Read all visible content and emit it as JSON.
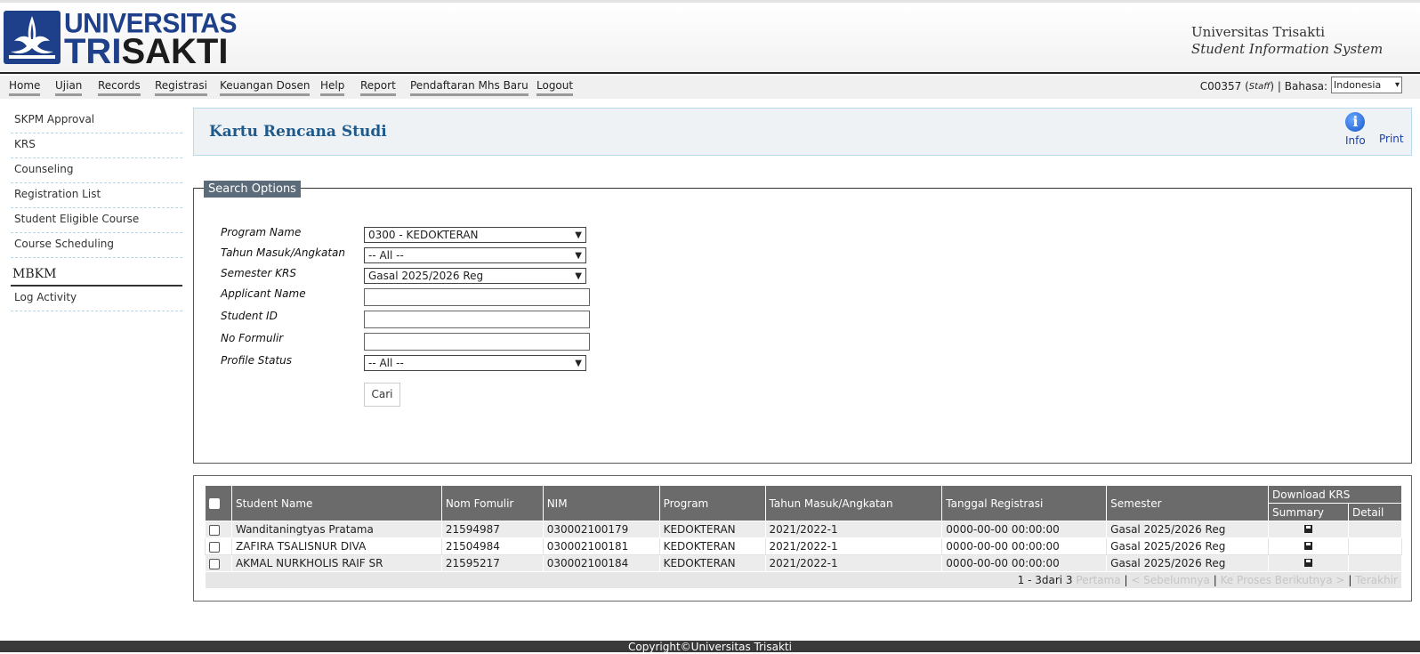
{
  "header": {
    "logo_line1": "UNIVERSITAS",
    "logo_tri": "TRI",
    "logo_sakti": "SAKTI",
    "university": "Universitas Trisakti",
    "system": "Student Information System"
  },
  "menu": {
    "items": [
      "Home",
      "Ujian",
      "Records",
      "Registrasi",
      "Keuangan Dosen",
      "Help",
      "Report",
      "Pendaftaran Mhs Baru",
      "Logout"
    ],
    "user_id": "C00357",
    "role": "Staff",
    "separator": "|",
    "language_label": "Bahasa:",
    "language_value": "Indonesia"
  },
  "sidebar": {
    "items": [
      "SKPM Approval",
      "KRS",
      "Counseling",
      "Registration List",
      "Student Eligible Course",
      "Course Scheduling"
    ],
    "heading": "MBKM",
    "items2": [
      "Log Activity"
    ]
  },
  "titlebar": {
    "title": "Kartu Rencana Studi",
    "info_label": "Info",
    "print_label": "Print"
  },
  "search": {
    "legend": "Search Options",
    "program_label": "Program Name",
    "program_value": "0300 - KEDOKTERAN",
    "tahun_label": "Tahun Masuk/Angkatan",
    "tahun_value": "-- All --",
    "semester_label": "Semester KRS",
    "semester_value": "Gasal 2025/2026 Reg",
    "applicant_label": "Applicant Name",
    "applicant_value": "",
    "student_id_label": "Student ID",
    "student_id_value": "",
    "formulir_label": "No Formulir",
    "formulir_value": "",
    "profile_label": "Profile Status",
    "profile_value": "-- All --",
    "button_label": "Cari"
  },
  "results": {
    "headers": {
      "student_name": "Student Name",
      "nom_formulir": "Nom Fomulir",
      "nim": "NIM",
      "program": "Program",
      "tahun": "Tahun Masuk/Angkatan",
      "tanggal": "Tanggal Registrasi",
      "semester": "Semester",
      "download": "Download KRS",
      "summary": "Summary",
      "detail": "Detail"
    },
    "rows": [
      {
        "name": "Wanditaningtyas Pratama",
        "formulir": "21594987",
        "nim": "030002100179",
        "program": "KEDOKTERAN",
        "tahun": "2021/2022-1",
        "tanggal": "0000-00-00 00:00:00",
        "semester": "Gasal 2025/2026 Reg"
      },
      {
        "name": "ZAFIRA TSALISNUR DIVA",
        "formulir": "21504984",
        "nim": "030002100181",
        "program": "KEDOKTERAN",
        "tahun": "2021/2022-1",
        "tanggal": "0000-00-00 00:00:00",
        "semester": "Gasal 2025/2026 Reg"
      },
      {
        "name": "AKMAL NURKHOLIS RAIF SR",
        "formulir": "21595217",
        "nim": "030002100184",
        "program": "KEDOKTERAN",
        "tahun": "2021/2022-1",
        "tanggal": "0000-00-00 00:00:00",
        "semester": "Gasal 2025/2026 Reg"
      }
    ],
    "pager": {
      "range": "1 - 3dari 3",
      "first": "Pertama",
      "prev": "< Sebelumnya",
      "next": "Ke Proses Berikutnya >",
      "last": "Terakhir",
      "sep": "|"
    }
  },
  "footer": {
    "copyright": "Copyright©Universitas Trisakti"
  }
}
